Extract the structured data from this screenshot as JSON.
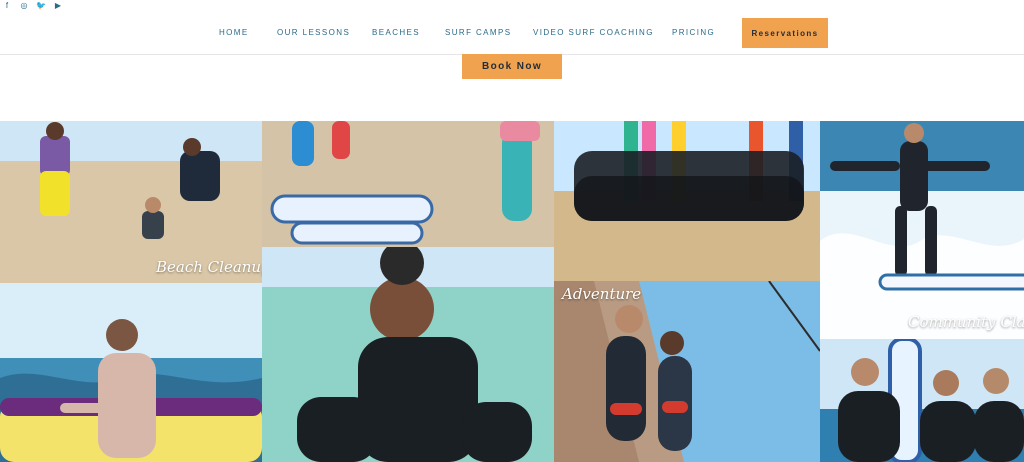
{
  "social": [
    {
      "name": "facebook-icon",
      "glyph": "f"
    },
    {
      "name": "instagram-icon",
      "glyph": "◎"
    },
    {
      "name": "twitter-icon",
      "glyph": "🐦"
    },
    {
      "name": "youtube-icon",
      "glyph": "▶"
    }
  ],
  "nav": {
    "home": "HOME",
    "lessons": "OUR LESSONS",
    "beaches": "BEACHES",
    "camps": "SURF CAMPS",
    "coaching": "VIDEO SURF COACHING",
    "pricing": "PRICING",
    "reservations": "Reservations"
  },
  "cta": {
    "book_now": "Book Now"
  },
  "gallery": {
    "beach_cleanups": "Beach Cleanups",
    "adventure": "Adventure",
    "community_classes": "Community Classes"
  },
  "colors": {
    "accent": "#f0a24f",
    "nav_text": "#2a6b8a",
    "sky": "#8fc1e6",
    "sand": "#d9c7a7"
  }
}
